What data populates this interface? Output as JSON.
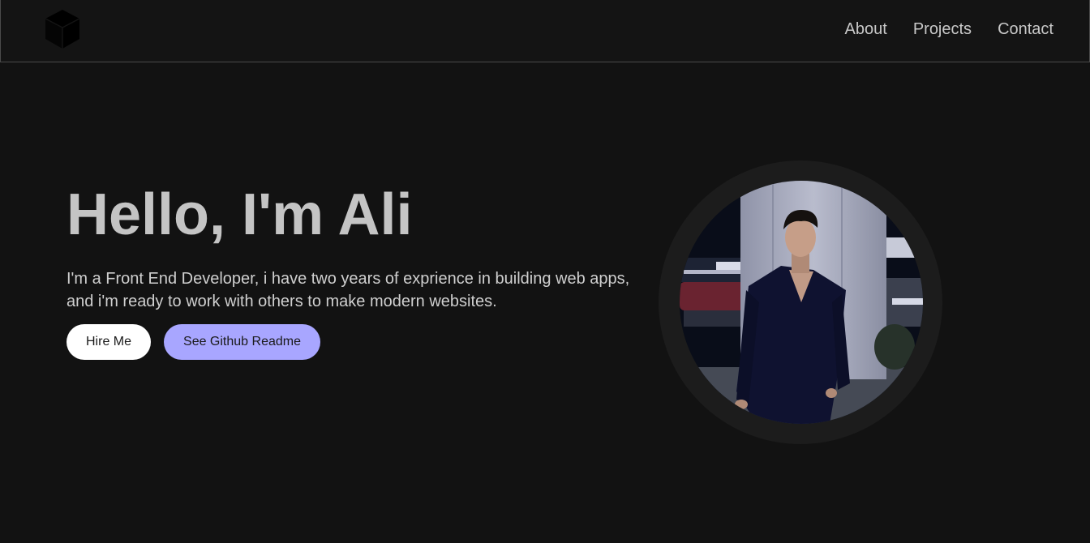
{
  "nav": {
    "logo_icon": "cube-icon",
    "links": [
      "About",
      "Projects",
      "Contact"
    ]
  },
  "hero": {
    "title": "Hello, I'm Ali",
    "description": "I'm a Front End Developer, i have two years of exprience in building web apps, and i'm ready to work with others to make modern websites.",
    "buttons": {
      "hire": "Hire Me",
      "github": "See Github Readme"
    },
    "photo_icon": "profile-photo"
  },
  "colors": {
    "background": "#121212",
    "text": "#c4c4c4",
    "primary_button": "#ffffff",
    "accent_button": "#a8a6ff"
  }
}
